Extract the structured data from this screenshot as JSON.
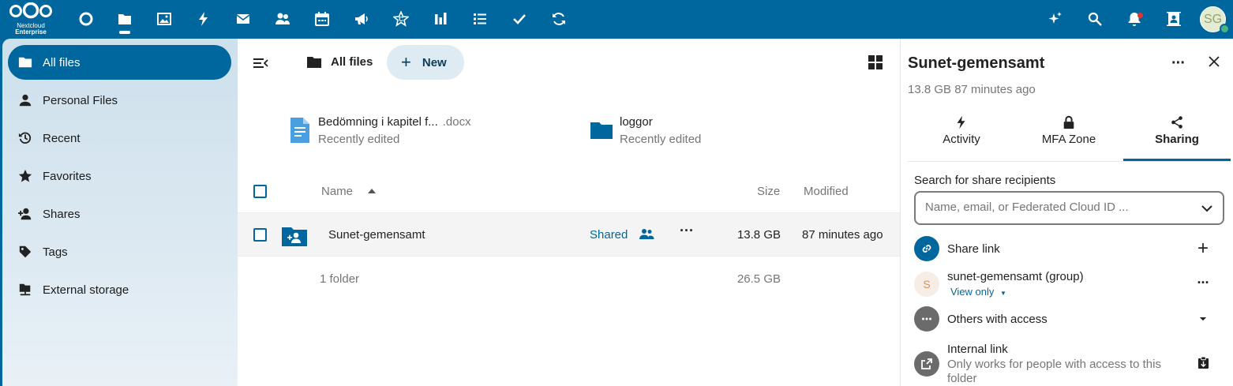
{
  "topbar": {
    "brand_line1": "Nextcloud",
    "brand_line2": "Enterprise",
    "apps": [
      "dashboard-icon",
      "files-icon",
      "photos-icon",
      "activity-icon",
      "mail-icon",
      "contacts-icon",
      "calendar-icon",
      "announcements-icon",
      "circles-icon",
      "analytics-icon",
      "tasks-list-icon",
      "tasks-check-icon",
      "sync-icon"
    ],
    "right_icons": [
      "assistant-icon",
      "search-icon",
      "notifications-icon",
      "contacts-menu-icon"
    ],
    "avatar_initials": "SG"
  },
  "nav": {
    "items": [
      {
        "label": "All files",
        "icon": "folder-icon",
        "active": true
      },
      {
        "label": "Personal Files",
        "icon": "person-icon"
      },
      {
        "label": "Recent",
        "icon": "history-icon"
      },
      {
        "label": "Favorites",
        "icon": "star-icon"
      },
      {
        "label": "Shares",
        "icon": "share-person-icon"
      },
      {
        "label": "Tags",
        "icon": "tag-icon"
      },
      {
        "label": "External storage",
        "icon": "external-storage-icon"
      }
    ]
  },
  "main": {
    "breadcrumb": "All files",
    "new_label": "New",
    "recent": [
      {
        "name": "Bedömning i kapitel f...",
        "ext": ".docx",
        "sub": "Recently edited"
      },
      {
        "name": "loggor",
        "ext": "",
        "sub": "Recently edited"
      }
    ],
    "columns": {
      "name": "Name",
      "size": "Size",
      "modified": "Modified"
    },
    "rows": [
      {
        "name": "Sunet-gemensamt",
        "shared": "Shared",
        "size": "13.8 GB",
        "modified": "87 minutes ago"
      }
    ],
    "summary": {
      "count": "1 folder",
      "size": "26.5 GB"
    }
  },
  "sidebar": {
    "title": "Sunet-gemensamt",
    "subtitle": "13.8 GB 87 minutes ago",
    "tabs": [
      {
        "label": "Activity",
        "icon": "activity-icon"
      },
      {
        "label": "MFA Zone",
        "icon": "lock-icon"
      },
      {
        "label": "Sharing",
        "icon": "share-icon",
        "active": true
      }
    ],
    "search_label": "Search for share recipients",
    "search_placeholder": "Name, email, or Federated Cloud ID ...",
    "share_link": "Share link",
    "group_initial": "S",
    "group_name": "sunet-gemensamt (group)",
    "group_permission": "View only",
    "others": "Others with access",
    "internal_link": "Internal link",
    "internal_desc": "Only works for people with access to this folder"
  },
  "colors": {
    "primary": "#00679e",
    "nav_bg": "#cde0ec",
    "folder": "#00679e",
    "doc": "#4a9fe0"
  }
}
